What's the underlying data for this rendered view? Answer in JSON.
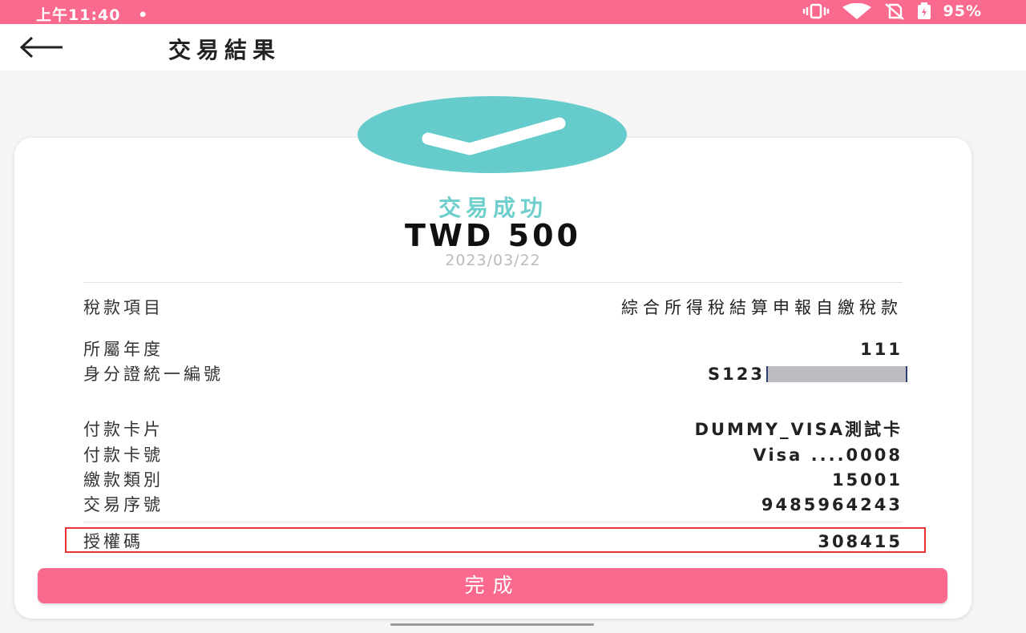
{
  "status_bar": {
    "time": "上午11:40",
    "dot": "•",
    "battery": "95%",
    "icons": [
      "vibrate-icon",
      "wifi-icon",
      "no-sim-icon",
      "battery-icon"
    ]
  },
  "app_bar": {
    "back_icon": "arrow-left-icon",
    "title": "交易結果"
  },
  "result": {
    "icon": "checkmark-icon",
    "status": "交易成功",
    "amount": "TWD 500",
    "date": "2023/03/22"
  },
  "details": {
    "tax_item": {
      "label": "稅款項目",
      "value": "綜合所得稅結算申報自繳稅款"
    },
    "tax_year": {
      "label": "所屬年度",
      "value": "111"
    },
    "id_number": {
      "label": "身分證統一編號",
      "value": "S123"
    },
    "card_name": {
      "label": "付款卡片",
      "value": "DUMMY_VISA測試卡"
    },
    "card_number": {
      "label": "付款卡號",
      "value": "Visa ....0008"
    },
    "payment_type": {
      "label": "繳款類別",
      "value": "15001"
    },
    "serial": {
      "label": "交易序號",
      "value": "9485964243"
    },
    "auth_code": {
      "label": "授權碼",
      "value": "308415"
    }
  },
  "done_button": "完成",
  "colors": {
    "brand_pink": "#fa6a8e",
    "success_teal": "#66cccb",
    "highlight_red": "#e63338"
  }
}
